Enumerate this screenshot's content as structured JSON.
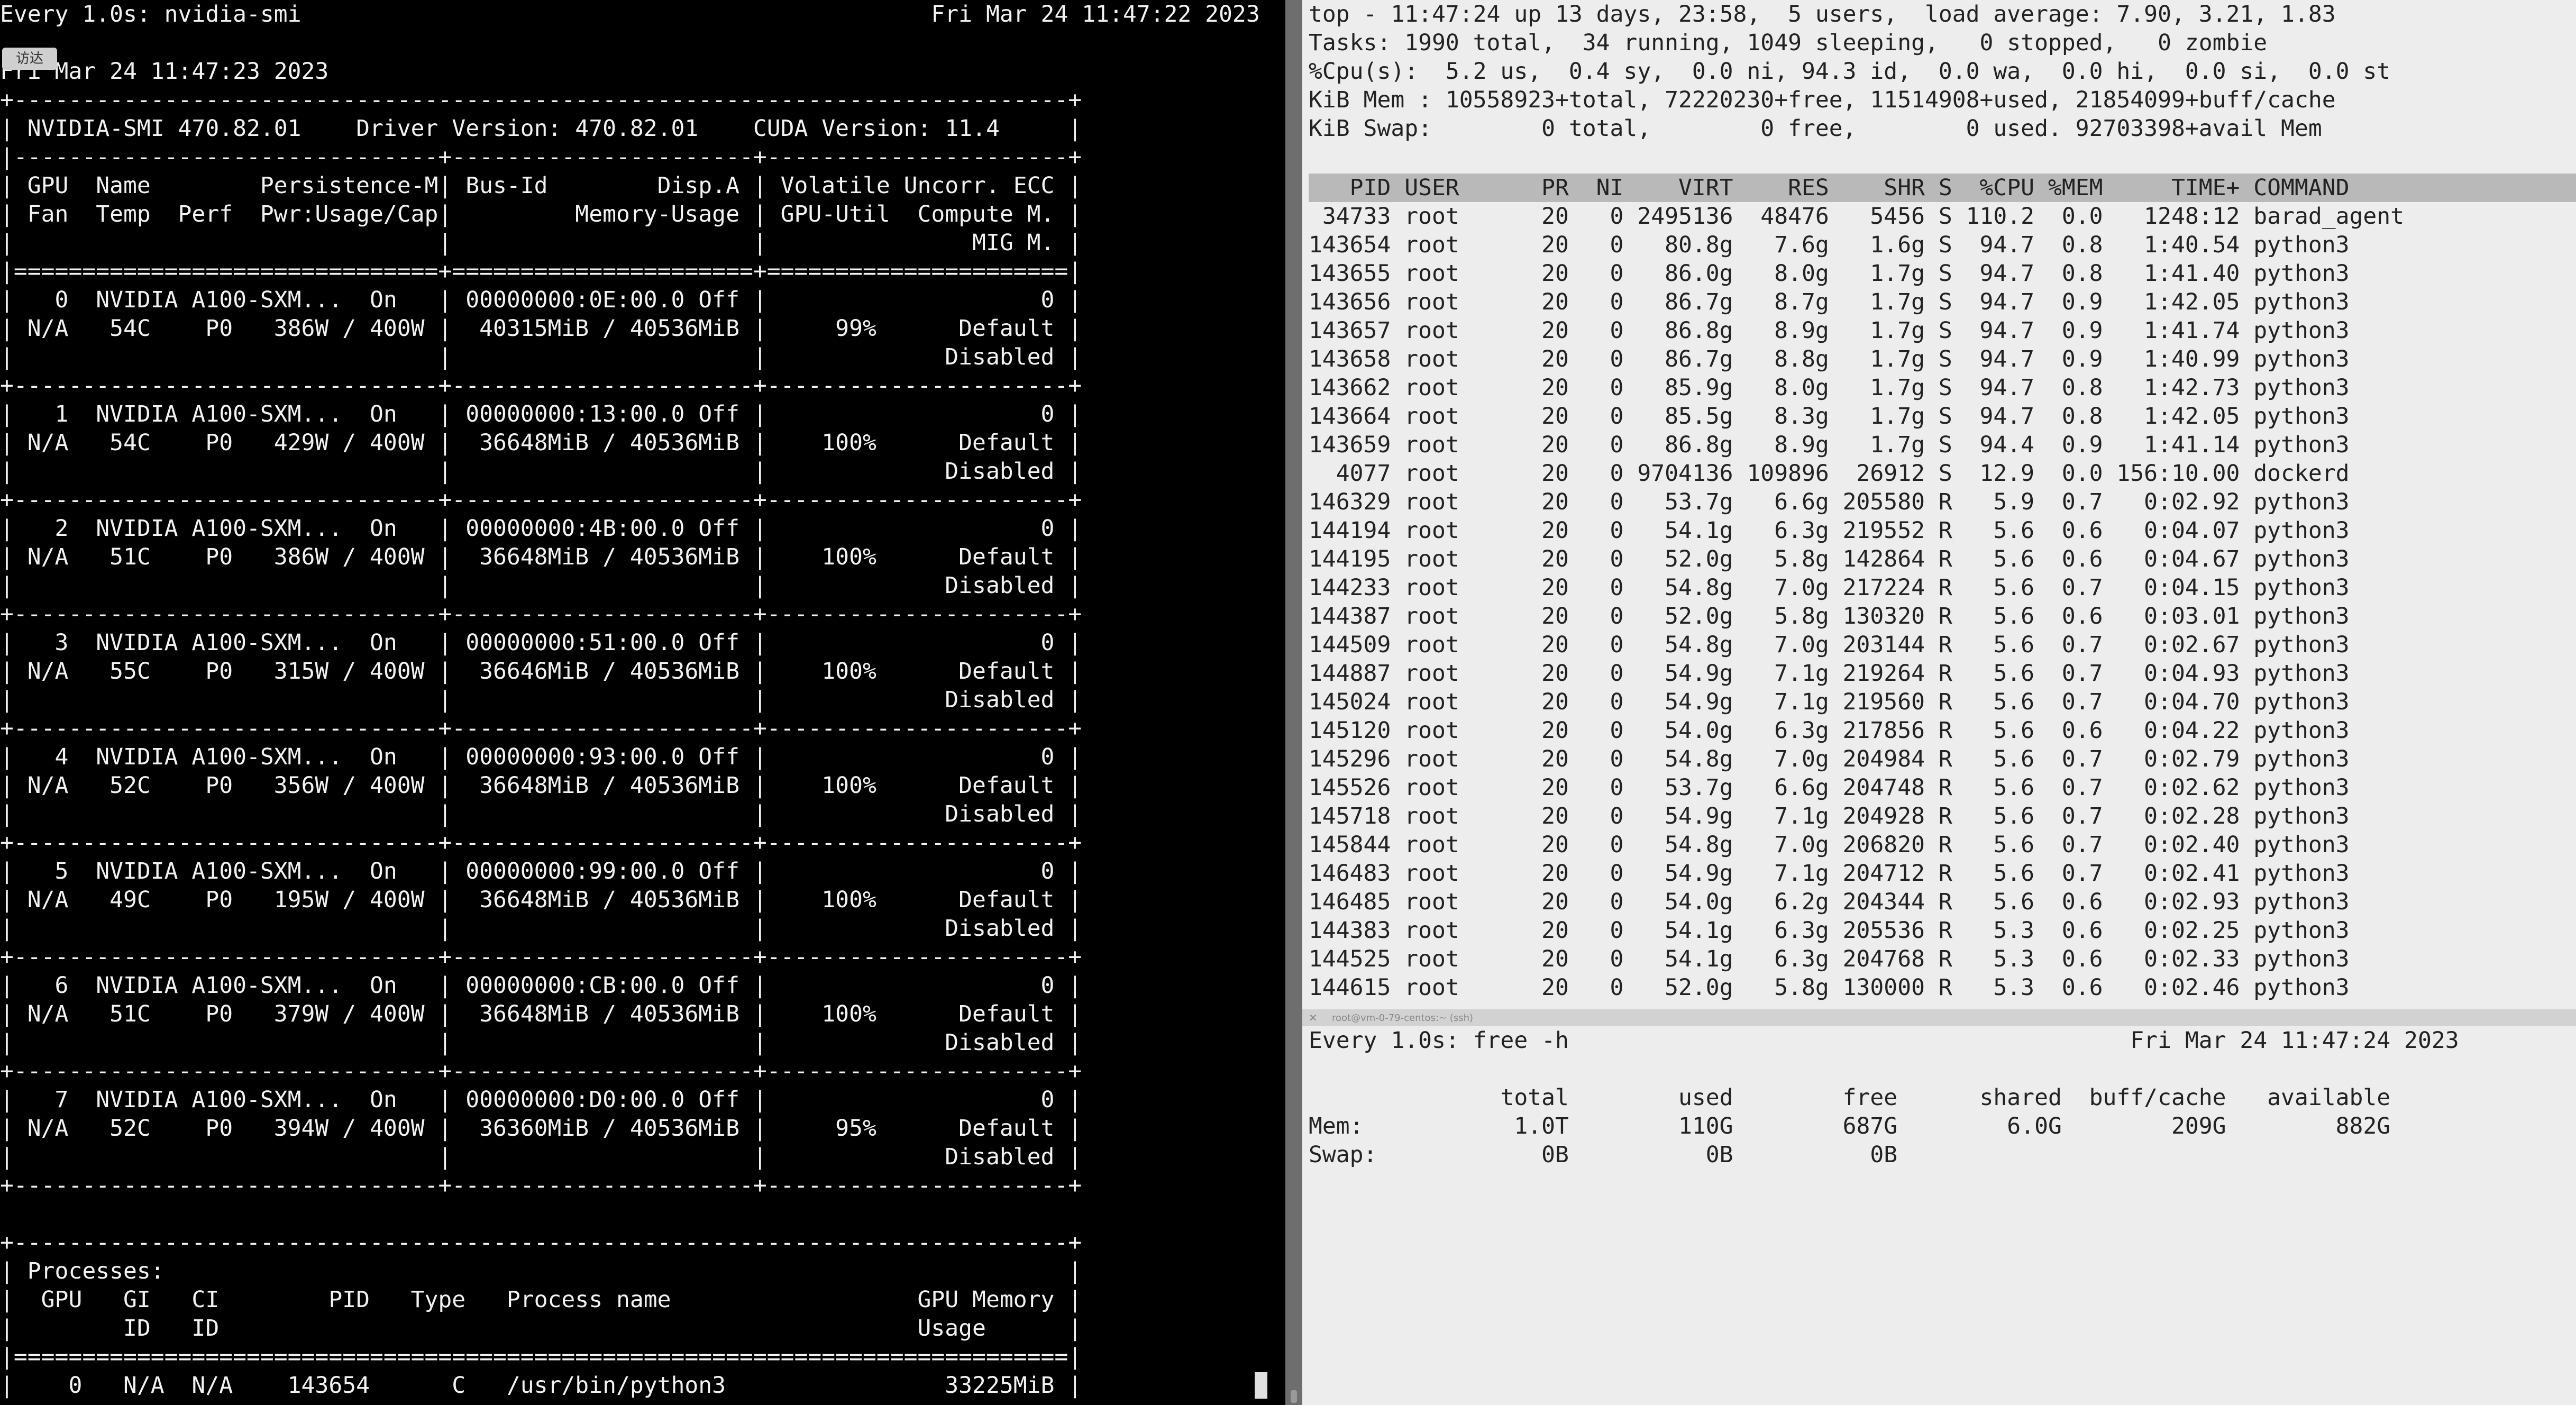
{
  "left_pane": {
    "badge": "访达",
    "text": "Every 1.0s: nvidia-smi                                              Fri Mar 24 11:47:22 2023\n\nFri Mar 24 11:47:23 2023\n+-----------------------------------------------------------------------------+\n| NVIDIA-SMI 470.82.01    Driver Version: 470.82.01    CUDA Version: 11.4     |\n|-------------------------------+----------------------+----------------------+\n| GPU  Name        Persistence-M| Bus-Id        Disp.A | Volatile Uncorr. ECC |\n| Fan  Temp  Perf  Pwr:Usage/Cap|         Memory-Usage | GPU-Util  Compute M. |\n|                               |                      |               MIG M. |\n|===============================+======================+======================|\n|   0  NVIDIA A100-SXM...  On   | 00000000:0E:00.0 Off |                    0 |\n| N/A   54C    P0   386W / 400W |  40315MiB / 40536MiB |     99%      Default |\n|                               |                      |             Disabled |\n+-------------------------------+----------------------+----------------------+\n|   1  NVIDIA A100-SXM...  On   | 00000000:13:00.0 Off |                    0 |\n| N/A   54C    P0   429W / 400W |  36648MiB / 40536MiB |    100%      Default |\n|                               |                      |             Disabled |\n+-------------------------------+----------------------+----------------------+\n|   2  NVIDIA A100-SXM...  On   | 00000000:4B:00.0 Off |                    0 |\n| N/A   51C    P0   386W / 400W |  36648MiB / 40536MiB |    100%      Default |\n|                               |                      |             Disabled |\n+-------------------------------+----------------------+----------------------+\n|   3  NVIDIA A100-SXM...  On   | 00000000:51:00.0 Off |                    0 |\n| N/A   55C    P0   315W / 400W |  36646MiB / 40536MiB |    100%      Default |\n|                               |                      |             Disabled |\n+-------------------------------+----------------------+----------------------+\n|   4  NVIDIA A100-SXM...  On   | 00000000:93:00.0 Off |                    0 |\n| N/A   52C    P0   356W / 400W |  36648MiB / 40536MiB |    100%      Default |\n|                               |                      |             Disabled |\n+-------------------------------+----------------------+----------------------+\n|   5  NVIDIA A100-SXM...  On   | 00000000:99:00.0 Off |                    0 |\n| N/A   49C    P0   195W / 400W |  36648MiB / 40536MiB |    100%      Default |\n|                               |                      |             Disabled |\n+-------------------------------+----------------------+----------------------+\n|   6  NVIDIA A100-SXM...  On   | 00000000:CB:00.0 Off |                    0 |\n| N/A   51C    P0   379W / 400W |  36648MiB / 40536MiB |    100%      Default |\n|                               |                      |             Disabled |\n+-------------------------------+----------------------+----------------------+\n|   7  NVIDIA A100-SXM...  On   | 00000000:D0:00.0 Off |                    0 |\n| N/A   52C    P0   394W / 400W |  36360MiB / 40536MiB |     95%      Default |\n|                               |                      |             Disabled |\n+-------------------------------+----------------------+----------------------+\n\n+-----------------------------------------------------------------------------+\n| Processes:                                                                  |\n|  GPU   GI   CI        PID   Type   Process name                  GPU Memory |\n|        ID   ID                                                   Usage      |\n|=============================================================================|\n|    0   N/A  N/A    143654      C   /usr/bin/python3                33225MiB |"
  },
  "top_pane": {
    "header": "top - 11:47:24 up 13 days, 23:58,  5 users,  load average: 7.90, 3.21, 1.83\nTasks: 1990 total,  34 running, 1049 sleeping,   0 stopped,   0 zombie\n%Cpu(s):  5.2 us,  0.4 sy,  0.0 ni, 94.3 id,  0.0 wa,  0.0 hi,  0.0 si,  0.0 st\nKiB Mem : 10558923+total, 72220230+free, 11514908+used, 21854099+buff/cache\nKiB Swap:        0 total,        0 free,        0 used. 92703398+avail Mem",
    "columns": "   PID USER      PR  NI    VIRT    RES    SHR S  %CPU %MEM     TIME+ COMMAND",
    "rows": " 34733 root      20   0 2495136  48476   5456 S 110.2  0.0   1248:12 barad_agent\n143654 root      20   0   80.8g   7.6g   1.6g S  94.7  0.8   1:40.54 python3\n143655 root      20   0   86.0g   8.0g   1.7g S  94.7  0.8   1:41.40 python3\n143656 root      20   0   86.7g   8.7g   1.7g S  94.7  0.9   1:42.05 python3\n143657 root      20   0   86.8g   8.9g   1.7g S  94.7  0.9   1:41.74 python3\n143658 root      20   0   86.7g   8.8g   1.7g S  94.7  0.9   1:40.99 python3\n143662 root      20   0   85.9g   8.0g   1.7g S  94.7  0.8   1:42.73 python3\n143664 root      20   0   85.5g   8.3g   1.7g S  94.7  0.8   1:42.05 python3\n143659 root      20   0   86.8g   8.9g   1.7g S  94.4  0.9   1:41.14 python3\n  4077 root      20   0 9704136 109896  26912 S  12.9  0.0 156:10.00 dockerd\n146329 root      20   0   53.7g   6.6g 205580 R   5.9  0.7   0:02.92 python3\n144194 root      20   0   54.1g   6.3g 219552 R   5.6  0.6   0:04.07 python3\n144195 root      20   0   52.0g   5.8g 142864 R   5.6  0.6   0:04.67 python3\n144233 root      20   0   54.8g   7.0g 217224 R   5.6  0.7   0:04.15 python3\n144387 root      20   0   52.0g   5.8g 130320 R   5.6  0.6   0:03.01 python3\n144509 root      20   0   54.8g   7.0g 203144 R   5.6  0.7   0:02.67 python3\n144887 root      20   0   54.9g   7.1g 219264 R   5.6  0.7   0:04.93 python3\n145024 root      20   0   54.9g   7.1g 219560 R   5.6  0.7   0:04.70 python3\n145120 root      20   0   54.0g   6.3g 217856 R   5.6  0.6   0:04.22 python3\n145296 root      20   0   54.8g   7.0g 204984 R   5.6  0.7   0:02.79 python3\n145526 root      20   0   53.7g   6.6g 204748 R   5.6  0.7   0:02.62 python3\n145718 root      20   0   54.9g   7.1g 204928 R   5.6  0.7   0:02.28 python3\n145844 root      20   0   54.8g   7.0g 206820 R   5.6  0.7   0:02.40 python3\n146483 root      20   0   54.9g   7.1g 204712 R   5.6  0.7   0:02.41 python3\n146485 root      20   0   54.0g   6.2g 204344 R   5.6  0.6   0:02.93 python3\n144383 root      20   0   54.1g   6.3g 205536 R   5.3  0.6   0:02.25 python3\n144525 root      20   0   54.1g   6.3g 204768 R   5.3  0.6   0:02.33 python3\n144615 root      20   0   52.0g   5.8g 130000 R   5.3  0.6   0:02.46 python3"
  },
  "split_bar": {
    "title": "root@vm-0-79-centos:~ (ssh)"
  },
  "free_pane": {
    "text": "Every 1.0s: free -h                                         Fri Mar 24 11:47:24 2023\n\n              total        used        free      shared  buff/cache   available\nMem:           1.0T        110G        687G        6.0G        209G        882G\nSwap:            0B          0B          0B"
  },
  "colors": {
    "left_bg": "#000000",
    "left_fg": "#f2f2f2",
    "right_bg": "#ededed",
    "right_fg": "#222222",
    "header_bar": "#b9b9b9"
  }
}
